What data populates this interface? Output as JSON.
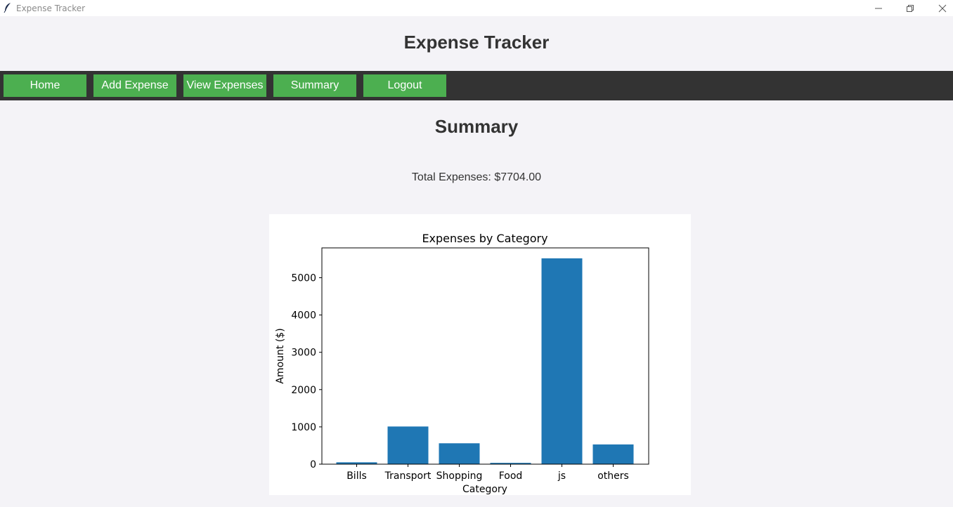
{
  "window": {
    "title": "Expense Tracker",
    "controls": [
      "minimize-icon",
      "restore-icon",
      "close-icon"
    ]
  },
  "app": {
    "title": "Expense Tracker"
  },
  "nav": {
    "items": [
      {
        "label": "Home"
      },
      {
        "label": "Add Expense"
      },
      {
        "label": "View Expenses"
      },
      {
        "label": "Summary"
      },
      {
        "label": "Logout"
      }
    ],
    "button_color": "#4caf50",
    "bar_color": "#333333"
  },
  "summary": {
    "title": "Summary",
    "total_text": "Total Expenses: $7704.00"
  },
  "chart_data": {
    "type": "bar",
    "title": "Expenses by Category",
    "xlabel": "Category",
    "ylabel": "Amount ($)",
    "categories": [
      "Bills",
      "Transport",
      "Shopping",
      "Food",
      "js",
      "others"
    ],
    "values": [
      50,
      1010,
      560,
      35,
      5520,
      529
    ],
    "ylim": [
      0,
      5800
    ],
    "yticks": [
      0,
      1000,
      2000,
      3000,
      4000,
      5000
    ],
    "grid": false,
    "bar_color": "#1f77b4"
  }
}
